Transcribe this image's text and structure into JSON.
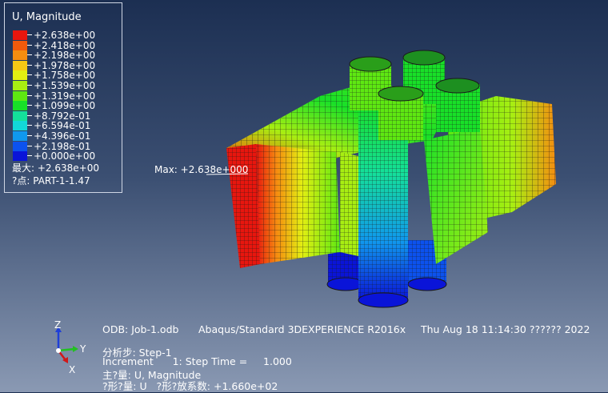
{
  "legend": {
    "title": "U, Magnitude",
    "levels": [
      {
        "label": "+2.638e+00",
        "color": "#e8160e"
      },
      {
        "label": "+2.418e+00",
        "color": "#f05a0c"
      },
      {
        "label": "+2.198e+00",
        "color": "#f58d10"
      },
      {
        "label": "+1.978e+00",
        "color": "#f5c815"
      },
      {
        "label": "+1.758e+00",
        "color": "#e2ef12"
      },
      {
        "label": "+1.539e+00",
        "color": "#a8ee12"
      },
      {
        "label": "+1.319e+00",
        "color": "#5ee812"
      },
      {
        "label": "+1.099e+00",
        "color": "#18e028"
      },
      {
        "label": "+8.792e-01",
        "color": "#14e09a"
      },
      {
        "label": "+6.594e-01",
        "color": "#12d8d8"
      },
      {
        "label": "+4.396e-01",
        "color": "#1098ee"
      },
      {
        "label": "+2.198e-01",
        "color": "#0c52ee"
      },
      {
        "label": "+0.000e+00",
        "color": "#0a14d8"
      }
    ],
    "max_line": "最大: +2.638e+00",
    "node_line": "?点: PART-1-1.47"
  },
  "max_annotation": "Max: +2.638e+000",
  "info": {
    "odb": "ODB: Job-1.odb",
    "solver": "Abaqus/Standard 3DEXPERIENCE R2016x",
    "date": "Thu Aug 18 11:14:30 ?????? 2022",
    "step": "分析步: Step-1",
    "increment": "Increment      1: Step Time =     1.000",
    "primary_var": "主?量: U, Magnitude",
    "deformed_var": "?形?量: U   ?形?放系数: +1.660e+02"
  },
  "triad": {
    "z": "Z",
    "y": "Y",
    "x": "X"
  },
  "colors": {
    "background_top": "#1c2f52",
    "background_bottom": "#8a99b3",
    "mesh": "#1a1a1a"
  }
}
